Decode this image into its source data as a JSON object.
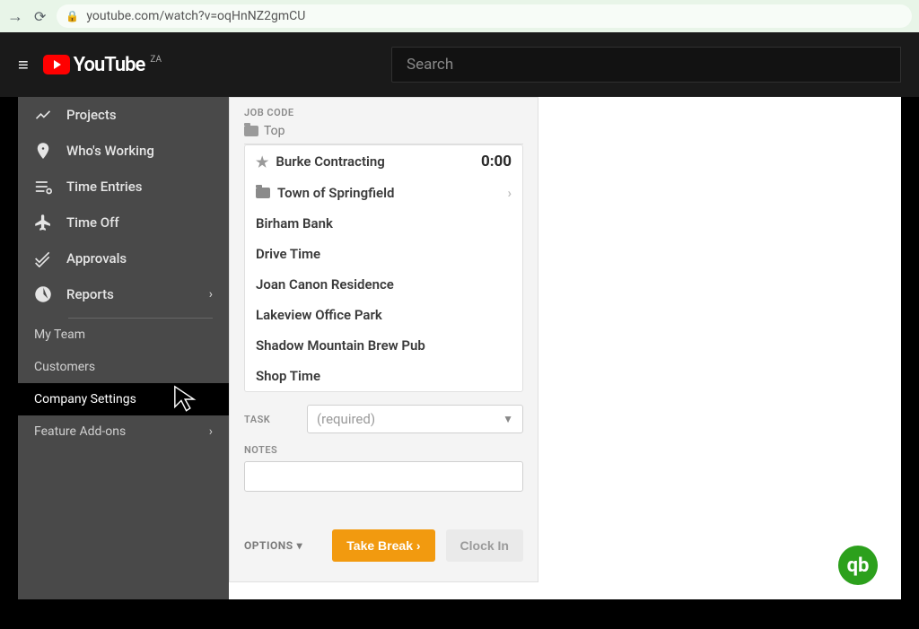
{
  "browser": {
    "url": "youtube.com/watch?v=oqHnNZ2gmCU"
  },
  "youtube": {
    "brand": "YouTube",
    "region": "ZA",
    "search_placeholder": "Search"
  },
  "sidebar": {
    "items": [
      {
        "label": "Projects"
      },
      {
        "label": "Who's Working"
      },
      {
        "label": "Time Entries"
      },
      {
        "label": "Time Off"
      },
      {
        "label": "Approvals"
      },
      {
        "label": "Reports"
      }
    ],
    "groups": [
      {
        "label": "My Team"
      },
      {
        "label": "Customers"
      },
      {
        "label": "Company Settings"
      },
      {
        "label": "Feature Add-ons"
      }
    ]
  },
  "panel": {
    "job_code_label": "JOB CODE",
    "breadcrumb": "Top",
    "jobs": [
      {
        "label": "Burke Contracting",
        "time": "0:00"
      },
      {
        "label": "Town of Springfield"
      },
      {
        "label": "Birham Bank"
      },
      {
        "label": "Drive Time"
      },
      {
        "label": "Joan Canon Residence"
      },
      {
        "label": "Lakeview Office Park"
      },
      {
        "label": "Shadow Mountain Brew Pub"
      },
      {
        "label": "Shop Time"
      }
    ],
    "task_label": "TASK",
    "task_placeholder": "(required)",
    "notes_label": "NOTES",
    "options_label": "OPTIONS",
    "take_break": "Take Break ›",
    "clock_in": "Clock In"
  },
  "qb": "qb"
}
